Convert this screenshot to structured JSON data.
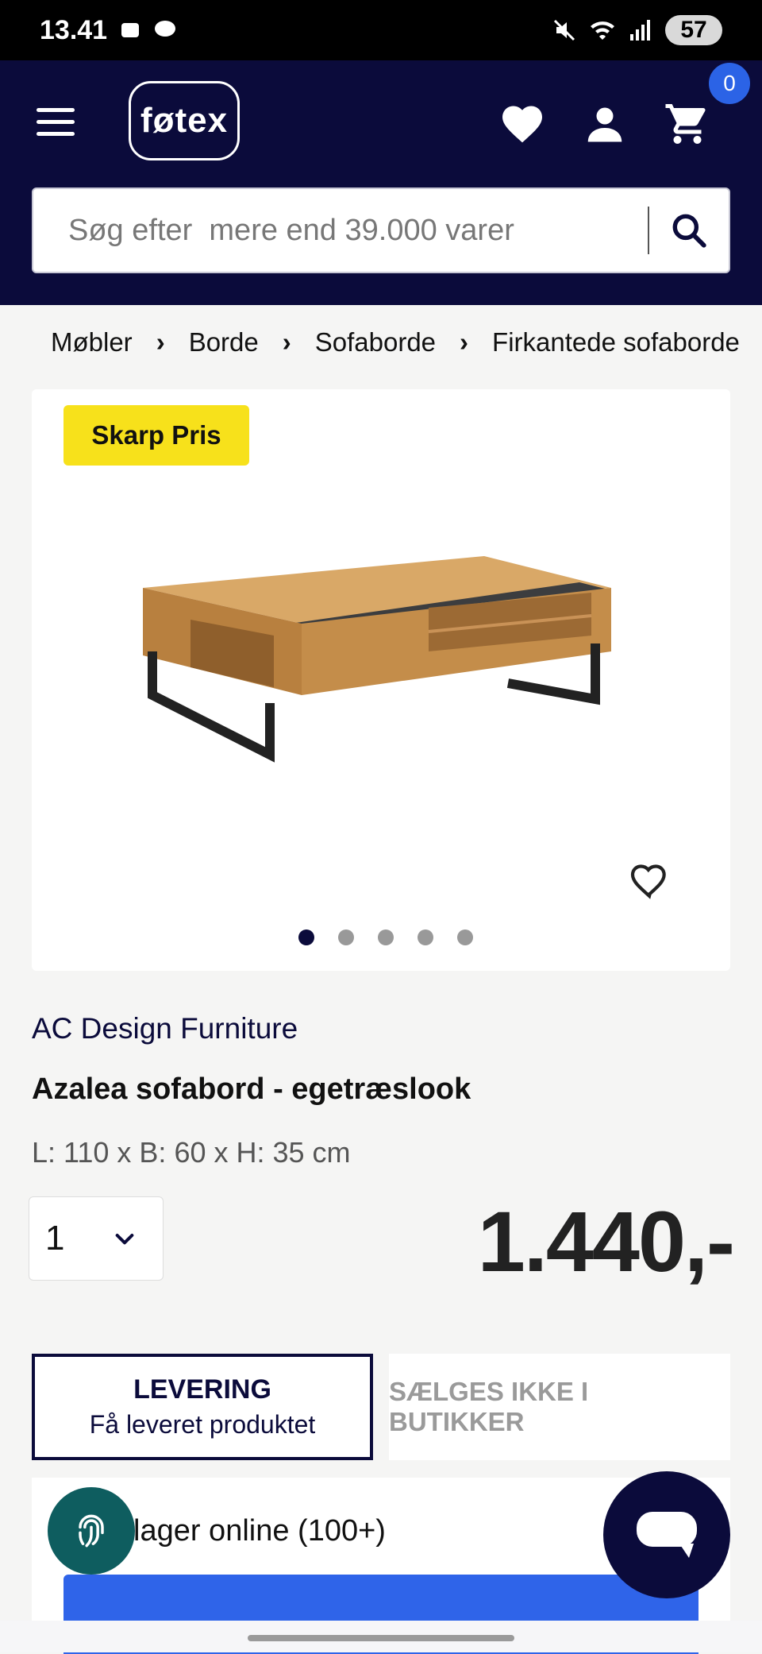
{
  "status_bar": {
    "time": "13.41",
    "battery": "57"
  },
  "header": {
    "logo_text": "føtex",
    "cart_count": "0",
    "search_placeholder": "Søg efter  mere end 39.000 varer"
  },
  "breadcrumb": [
    "Møbler",
    "Borde",
    "Sofaborde",
    "Firkantede sofaborde"
  ],
  "product": {
    "badge": "Skarp Pris",
    "brand": "AC Design Furniture",
    "title": "Azalea sofabord - egetræslook",
    "dimensions": "L: 110 x B: 60 x H: 35 cm",
    "quantity": "1",
    "price": "1.440,-",
    "image_dots": 5,
    "active_dot": 1
  },
  "fulfillment": {
    "delivery_title": "LEVERING",
    "delivery_subtitle": "Få leveret produktet",
    "store_label": "SÆLGES IKKE I BUTIKKER",
    "stock_text": "lager online (100+)"
  },
  "colors": {
    "navy": "#0b0b3b",
    "badge_yellow": "#f7e11b",
    "cta_blue": "#2f64e9",
    "cart_badge_blue": "#2b63e6"
  }
}
